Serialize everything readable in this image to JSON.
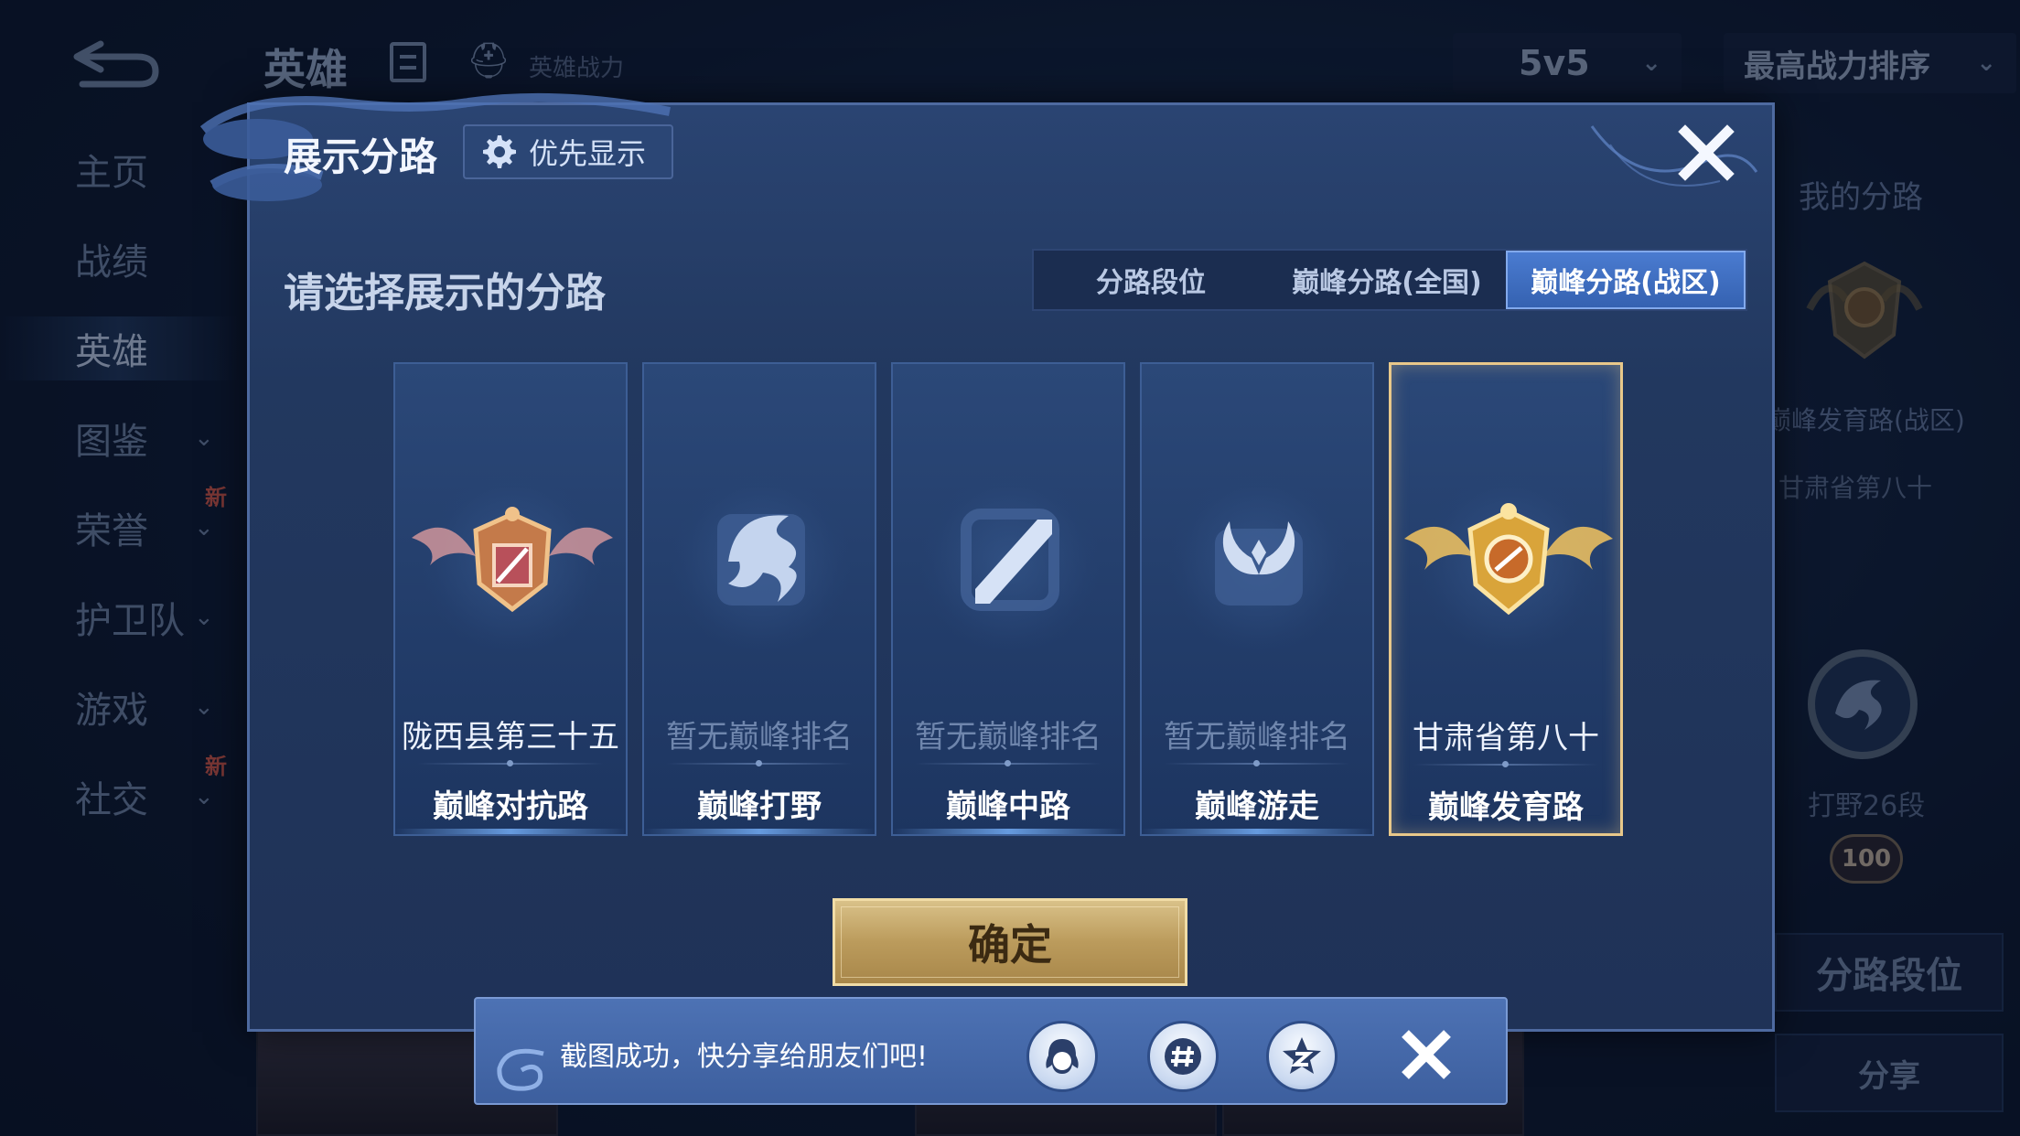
{
  "background": {
    "header_title": "英雄",
    "power_label": "英雄战力",
    "mode_select": "5v5",
    "sort_select": "最高战力排序",
    "nav": [
      {
        "label": "主页",
        "active": false,
        "chevron": false,
        "new": false
      },
      {
        "label": "战绩",
        "active": false,
        "chevron": false,
        "new": false
      },
      {
        "label": "英雄",
        "active": true,
        "chevron": false,
        "new": false
      },
      {
        "label": "图鉴",
        "active": false,
        "chevron": true,
        "new": false
      },
      {
        "label": "荣誉",
        "active": false,
        "chevron": true,
        "new": true
      },
      {
        "label": "护卫队",
        "active": false,
        "chevron": true,
        "new": false
      },
      {
        "label": "游戏",
        "active": false,
        "chevron": true,
        "new": false
      },
      {
        "label": "社交",
        "active": false,
        "chevron": true,
        "new": true
      }
    ],
    "new_tag": "新",
    "right_panel": {
      "title": "我的分路",
      "rank_label": "巅峰发育路(战区)",
      "region": "甘肃省第八十",
      "jungle_label": "打野26段",
      "level_badge": "100",
      "lane_rank_button": "分路段位",
      "share_button": "分享"
    }
  },
  "modal": {
    "title": "展示分路",
    "priority_button": "优先显示",
    "subtitle": "请选择展示的分路",
    "tabs": [
      "分路段位",
      "巅峰分路(全国)",
      "巅峰分路(战区)"
    ],
    "active_tab": 2,
    "cards": [
      {
        "rank": "陇西县第三十五",
        "lane": "巅峰对抗路",
        "ranked": true,
        "selected": false,
        "icon": "clash-lane-emblem-icon"
      },
      {
        "rank": "暂无巅峰排名",
        "lane": "巅峰打野",
        "ranked": false,
        "selected": false,
        "icon": "jungle-dragon-icon"
      },
      {
        "rank": "暂无巅峰排名",
        "lane": "巅峰中路",
        "ranked": false,
        "selected": false,
        "icon": "mid-lane-slash-icon"
      },
      {
        "rank": "暂无巅峰排名",
        "lane": "巅峰游走",
        "ranked": false,
        "selected": false,
        "icon": "roam-wings-icon"
      },
      {
        "rank": "甘肃省第八十",
        "lane": "巅峰发育路",
        "ranked": true,
        "selected": true,
        "icon": "farm-lane-emblem-icon"
      }
    ],
    "confirm_button": "确定"
  },
  "toast": {
    "message": "截图成功，快分享给朋友们吧!",
    "share_targets": [
      "qq-icon",
      "hashtag-icon",
      "qzone-icon"
    ]
  },
  "colors": {
    "selected_border": "#e8c88a",
    "active_tab": "#3f6fc4",
    "confirm_gold": "#c8a96a",
    "new_tag": "#d95a4b"
  }
}
